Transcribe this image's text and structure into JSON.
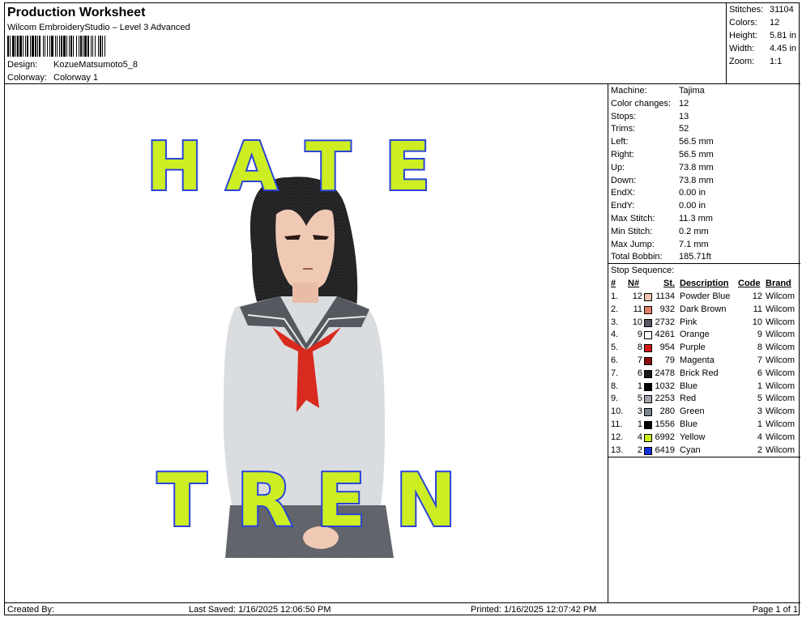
{
  "header": {
    "title": "Production Worksheet",
    "subtitle": "Wilcom EmbroideryStudio – Level 3 Advanced",
    "design_label": "Design:",
    "design_value": "KozueMatsumoto5_8",
    "colorway_label": "Colorway:",
    "colorway_value": "Colorway 1"
  },
  "stats": [
    {
      "label": "Stitches:",
      "value": "31104"
    },
    {
      "label": "Colors:",
      "value": "12"
    },
    {
      "label": "Height:",
      "value": "5.81 in"
    },
    {
      "label": "Width:",
      "value": "4.45 in"
    },
    {
      "label": "Zoom:",
      "value": "1:1"
    }
  ],
  "machine": [
    {
      "label": "Machine:",
      "value": "Tajima"
    },
    {
      "label": "Color changes:",
      "value": "12"
    },
    {
      "label": "Stops:",
      "value": "13"
    },
    {
      "label": "Trims:",
      "value": "52"
    },
    {
      "label": "Left:",
      "value": "56.5 mm"
    },
    {
      "label": "Right:",
      "value": "56.5 mm"
    },
    {
      "label": "Up:",
      "value": "73.8 mm"
    },
    {
      "label": "Down:",
      "value": "73.8 mm"
    },
    {
      "label": "EndX:",
      "value": "0.00 in"
    },
    {
      "label": "EndY:",
      "value": "0.00 in"
    },
    {
      "label": "Max Stitch:",
      "value": "11.3 mm"
    },
    {
      "label": "Min Stitch:",
      "value": "0.2 mm"
    },
    {
      "label": "Max Jump:",
      "value": "7.1 mm"
    },
    {
      "label": "Total Bobbin:",
      "value": "185.71ft"
    }
  ],
  "stop_sequence": {
    "title": "Stop Sequence:",
    "headers": {
      "idx": "#",
      "n": "N#",
      "st": "St.",
      "desc": "Description",
      "code": "Code",
      "brand": "Brand"
    },
    "rows": [
      {
        "idx": "1.",
        "n": "12",
        "color": "#f2c4b4",
        "st": "1134",
        "desc": "Powder Blue",
        "code": "12",
        "brand": "Wilcom"
      },
      {
        "idx": "2.",
        "n": "11",
        "color": "#e0826a",
        "st": "932",
        "desc": "Dark Brown",
        "code": "11",
        "brand": "Wilcom"
      },
      {
        "idx": "3.",
        "n": "10",
        "color": "#555860",
        "st": "2732",
        "desc": "Pink",
        "code": "10",
        "brand": "Wilcom"
      },
      {
        "idx": "4.",
        "n": "9",
        "color": "#ffffff",
        "st": "4261",
        "desc": "Orange",
        "code": "9",
        "brand": "Wilcom"
      },
      {
        "idx": "5.",
        "n": "8",
        "color": "#d41a1a",
        "st": "954",
        "desc": "Purple",
        "code": "8",
        "brand": "Wilcom"
      },
      {
        "idx": "6.",
        "n": "7",
        "color": "#8a0c0c",
        "st": "79",
        "desc": "Magenta",
        "code": "7",
        "brand": "Wilcom"
      },
      {
        "idx": "7.",
        "n": "6",
        "color": "#1a1a1a",
        "st": "2478",
        "desc": "Brick Red",
        "code": "6",
        "brand": "Wilcom"
      },
      {
        "idx": "8.",
        "n": "1",
        "color": "#000000",
        "st": "1032",
        "desc": "Blue",
        "code": "1",
        "brand": "Wilcom"
      },
      {
        "idx": "9.",
        "n": "5",
        "color": "#a3a6b0",
        "st": "2253",
        "desc": "Red",
        "code": "5",
        "brand": "Wilcom"
      },
      {
        "idx": "10.",
        "n": "3",
        "color": "#7d8494",
        "st": "280",
        "desc": "Green",
        "code": "3",
        "brand": "Wilcom"
      },
      {
        "idx": "11.",
        "n": "1",
        "color": "#000000",
        "st": "1556",
        "desc": "Blue",
        "code": "1",
        "brand": "Wilcom"
      },
      {
        "idx": "12.",
        "n": "4",
        "color": "#ccee11",
        "st": "6992",
        "desc": "Yellow",
        "code": "4",
        "brand": "Wilcom"
      },
      {
        "idx": "13.",
        "n": "2",
        "color": "#1133dd",
        "st": "6419",
        "desc": "Cyan",
        "code": "2",
        "brand": "Wilcom"
      }
    ]
  },
  "design": {
    "text_top": "HATE",
    "text_bottom": "TREN",
    "fill_color": "#ccee22",
    "outline_color": "#2a44d8"
  },
  "footer": {
    "created_by": "Created By:",
    "last_saved": "Last Saved: 1/16/2025 12:06:50 PM",
    "printed": "Printed: 1/16/2025 12:07:42 PM",
    "page": "Page 1 of 1"
  }
}
